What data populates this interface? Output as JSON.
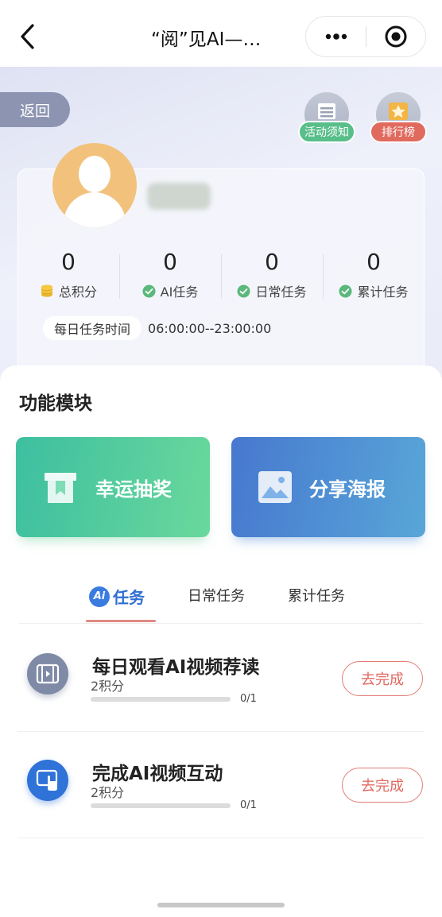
{
  "navbar": {
    "title": "“阅”见AI—…"
  },
  "header": {
    "back_label": "返回",
    "notice_label": "活动须知",
    "rank_label": "排行榜"
  },
  "stats": [
    {
      "value": "0",
      "label": "总积分",
      "icon": "coin-stack-icon"
    },
    {
      "value": "0",
      "label": "AI任务",
      "icon": "check-circle-icon"
    },
    {
      "value": "0",
      "label": "日常任务",
      "icon": "check-circle-icon"
    },
    {
      "value": "0",
      "label": "累计任务",
      "icon": "check-circle-icon"
    }
  ],
  "daily_time": {
    "label": "每日任务时间",
    "value": "06:00:00--23:00:00"
  },
  "modules": {
    "title": "功能模块",
    "lottery_label": "幸运抽奖",
    "poster_label": "分享海报"
  },
  "tabs": {
    "ai_badge": "Ai",
    "ai_label": "任务",
    "daily_label": "日常任务",
    "total_label": "累计任务"
  },
  "tasks": [
    {
      "title": "每日观看AI视频荐读",
      "points": "2积分",
      "progress": "0/1",
      "progress_fraction": 0,
      "button": "去完成",
      "icon": "film-icon"
    },
    {
      "title": "完成AI视频互动",
      "points": "2积分",
      "progress": "0/1",
      "progress_fraction": 0,
      "button": "去完成",
      "icon": "touch-screen-icon"
    }
  ],
  "colors": {
    "accent_red": "#e06a61",
    "accent_blue": "#2f6fd1",
    "lottery_green": "#3dbfa0",
    "poster_blue": "#4778cf"
  }
}
